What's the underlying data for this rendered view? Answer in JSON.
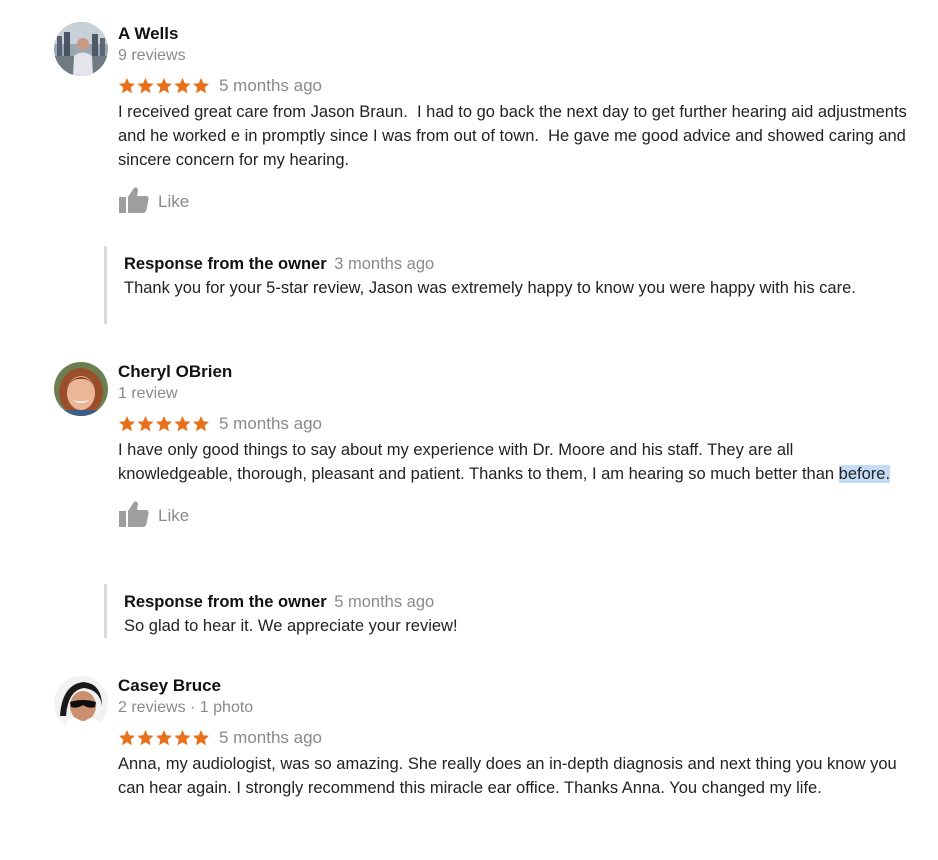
{
  "reviews": [
    {
      "name": "A Wells",
      "meta": "9 reviews",
      "rating": 5,
      "time": "5 months ago",
      "text": "I received great care from Jason Braun.  I had to go back the next day to get further hearing aid adjustments and he worked e in promptly since I was from out of town.  He gave me good advice and showed caring and sincere concern for my hearing.",
      "like_label": "Like",
      "response": {
        "title": "Response from the owner",
        "time": "3 months ago",
        "text": "Thank you for your 5-star review, Jason was extremely happy to know you were happy with his care."
      }
    },
    {
      "name": "Cheryl OBrien",
      "meta": "1 review",
      "rating": 5,
      "time": "5 months ago",
      "text_main": "I have only good things to say about my experience with Dr. Moore and his staff. They are all knowledgeable, thorough, pleasant and patient. Thanks to them, I am hearing so much better than ",
      "text_highlight": "before.",
      "like_label": "Like",
      "response": {
        "title": "Response from the owner",
        "time": "5 months ago",
        "text": "So glad to hear it. We appreciate your review!"
      }
    },
    {
      "name": "Casey Bruce",
      "meta": "2 reviews · 1 photo",
      "rating": 5,
      "time": "5 months ago",
      "text": "Anna, my audiologist, was so amazing. She really does an in-depth diagnosis and next thing you know you can hear again. I strongly recommend this miracle ear office. Thanks Anna. You changed my life."
    }
  ],
  "colors": {
    "star": "#e7711b",
    "muted": "#8a8a8a",
    "text": "#222222",
    "highlight": "#c5dcf7",
    "response_border": "#dadada"
  },
  "icons": {
    "star": "star-icon",
    "like": "thumbs-up-icon"
  }
}
